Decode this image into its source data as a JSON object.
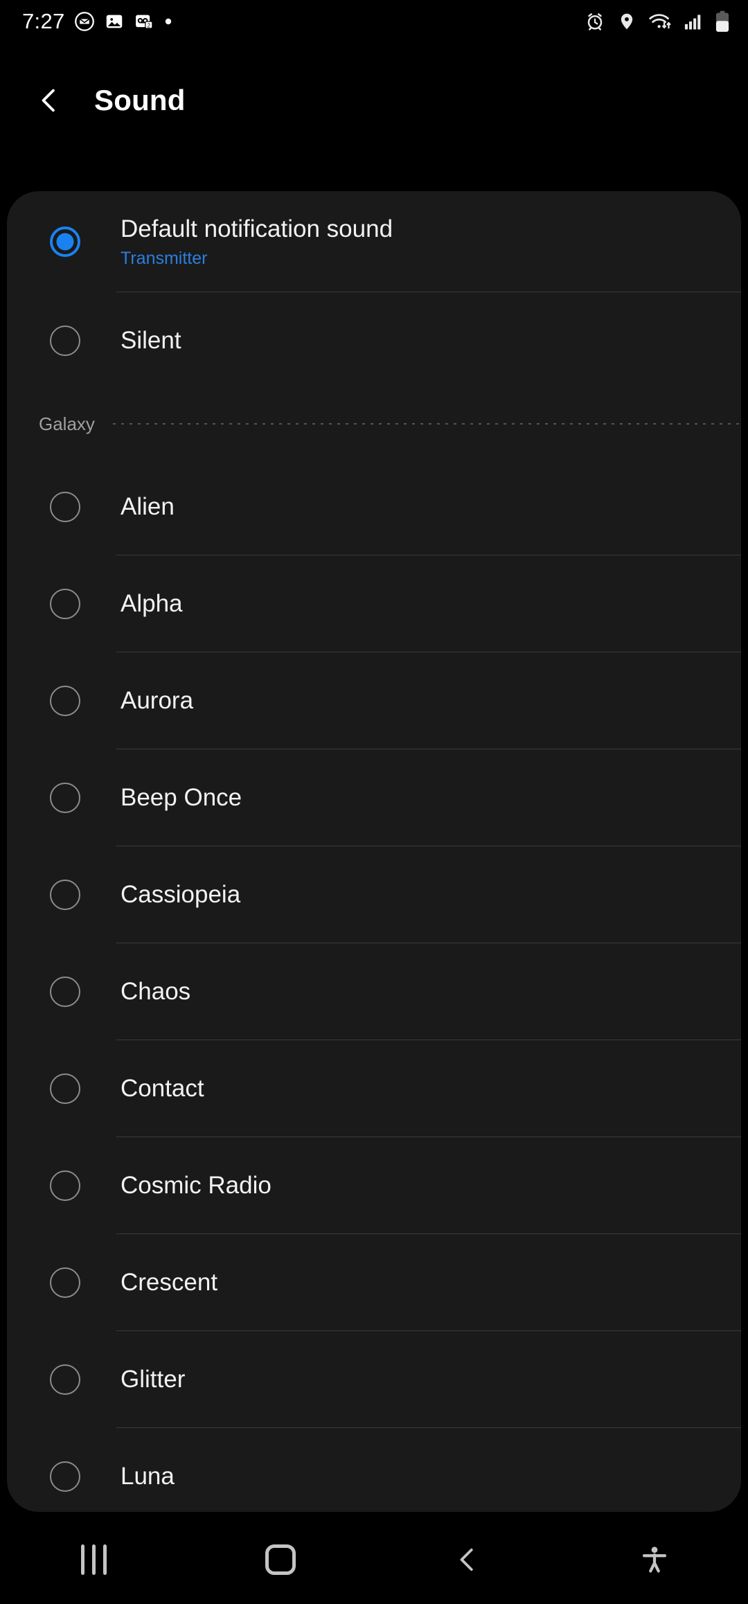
{
  "status_bar": {
    "time": "7:27",
    "left_icons": [
      "mail-circle-icon",
      "gallery-icon",
      "voicemail-badge-icon",
      "dot-indicator-icon"
    ],
    "right_icons": [
      "alarm-icon",
      "location-icon",
      "wifi-icon",
      "signal-icon",
      "battery-icon"
    ],
    "battery_level": 58
  },
  "header": {
    "back_label": "back-chevron",
    "title": "Sound"
  },
  "colors": {
    "accent": "#1a82f0",
    "subtitle": "#2a7fe0",
    "card_bg": "#1a1a1a",
    "page_bg": "#000000",
    "divider": "#3a3a3a",
    "text": "#f2f2f2",
    "muted": "#a0a0a0"
  },
  "list": {
    "top_items": [
      {
        "label": "Default notification sound",
        "sublabel": "Transmitter",
        "selected": true
      },
      {
        "label": "Silent",
        "sublabel": "",
        "selected": false
      }
    ],
    "section": {
      "label": "Galaxy"
    },
    "galaxy_items": [
      {
        "label": "Alien",
        "selected": false
      },
      {
        "label": "Alpha",
        "selected": false
      },
      {
        "label": "Aurora",
        "selected": false
      },
      {
        "label": "Beep Once",
        "selected": false
      },
      {
        "label": "Cassiopeia",
        "selected": false
      },
      {
        "label": "Chaos",
        "selected": false
      },
      {
        "label": "Contact",
        "selected": false
      },
      {
        "label": "Cosmic Radio",
        "selected": false
      },
      {
        "label": "Crescent",
        "selected": false
      },
      {
        "label": "Glitter",
        "selected": false
      },
      {
        "label": "Luna",
        "selected": false
      }
    ]
  },
  "navbar": {
    "items": [
      {
        "name": "recent-apps",
        "icon": "recent-apps-icon"
      },
      {
        "name": "home",
        "icon": "home-icon"
      },
      {
        "name": "back",
        "icon": "back-chevron-icon"
      },
      {
        "name": "accessibility",
        "icon": "accessibility-icon"
      }
    ]
  }
}
